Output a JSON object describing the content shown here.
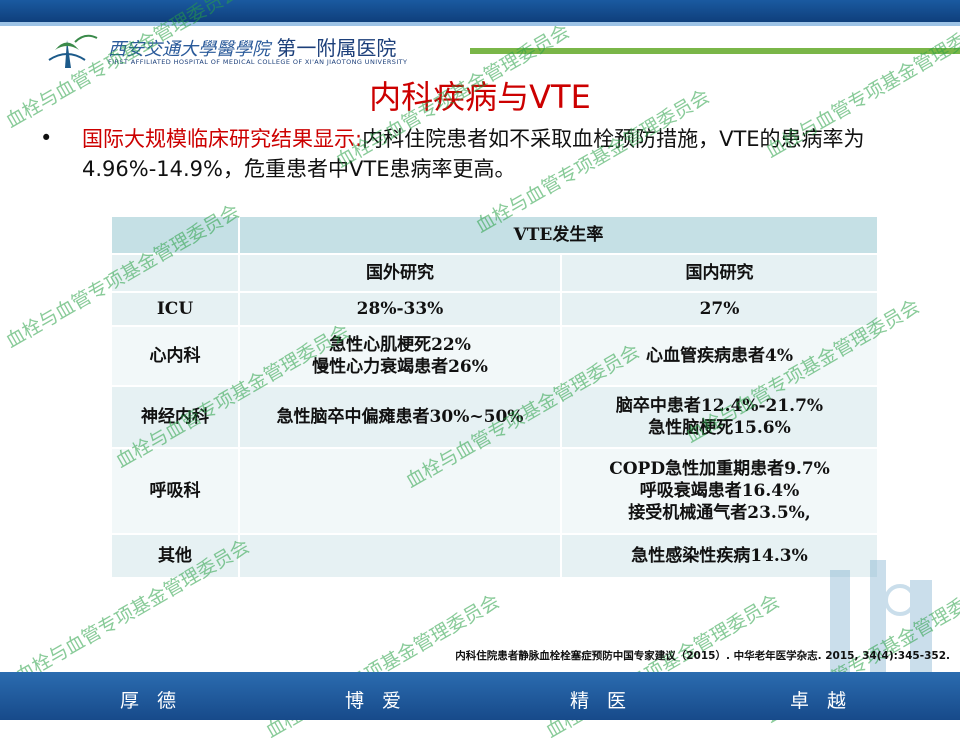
{
  "header": {
    "hospital_cn_script": "西安交通大學醫學院",
    "hospital_cn": "第一附属医院",
    "hospital_en": "FIRST AFFILIATED HOSPITAL OF MEDICAL COLLEGE OF XI'AN JIAOTONG UNIVERSITY"
  },
  "title": "内科疾病与VTE",
  "bullet": {
    "red_part": "国际大规模临床研究结果显示:",
    "black_part": "内科住院患者如不采取血栓预防措施，VTE的患病率为4.96%-14.9%，危重患者中VTE患病率更高。"
  },
  "table": {
    "header": "VTE发生率",
    "col_foreign": "国外研究",
    "col_domestic": "国内研究",
    "rows": [
      {
        "dept": "ICU",
        "foreign": "28%-33%",
        "domestic": "27%"
      },
      {
        "dept": "心内科",
        "foreign": "急性心肌梗死22%\n慢性心力衰竭患者26%",
        "domestic": "心血管疾病患者4%"
      },
      {
        "dept": "神经内科",
        "foreign": "急性脑卒中偏瘫患者30%~50%",
        "domestic": "脑卒中患者12.4%-21.7%\n急性脑梗死15.6%"
      },
      {
        "dept": "呼吸科",
        "foreign": "",
        "domestic": "COPD急性加重期患者9.7%\n呼吸衰竭患者16.4%\n接受机械通气者23.5%,"
      },
      {
        "dept": "其他",
        "foreign": "",
        "domestic": "急性感染性疾病14.3%"
      }
    ]
  },
  "reference": "内科住院患者静脉血栓栓塞症预防中国专家建议（2015）. 中华老年医学杂志. 2015, 34(4):345-352.",
  "motto": [
    "厚德",
    "博爱",
    "精医",
    "卓越"
  ],
  "watermark_text": "血栓与血管专项基金管理委员会",
  "colors": {
    "title_red": "#cc0000",
    "header_cell": "#c5e0e5",
    "band_blue": "#174a8a",
    "accent_green": "#7ab648"
  }
}
